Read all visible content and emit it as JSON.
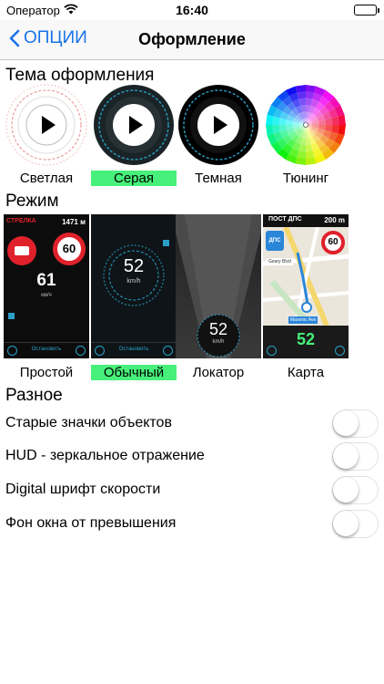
{
  "status_bar": {
    "carrier": "Оператор",
    "time": "16:40"
  },
  "nav": {
    "back_label": "ОПЦИИ",
    "title": "Оформление"
  },
  "theme_section": {
    "title": "Тема оформления",
    "items": [
      {
        "label": "Светлая",
        "selected": false
      },
      {
        "label": "Серая",
        "selected": true
      },
      {
        "label": "Темная",
        "selected": false
      },
      {
        "label": "Тюнинг",
        "selected": false
      }
    ]
  },
  "mode_section": {
    "title": "Режим",
    "items": [
      {
        "label": "Простой",
        "selected": false
      },
      {
        "label": "Обычный",
        "selected": true
      },
      {
        "label": "Локатор",
        "selected": false
      },
      {
        "label": "Карта",
        "selected": false
      }
    ],
    "previews": {
      "simple": {
        "header": "СТРЕЛКА",
        "distance": "1471 м",
        "limit": "60",
        "speed": "61",
        "unit": "км/ч",
        "stop": "Остановить"
      },
      "normal": {
        "speed": "52",
        "unit": "km/h",
        "stop": "Остановить"
      },
      "locator": {
        "speed": "52",
        "unit": "km/h"
      },
      "map": {
        "header": "ПОСТ ДПС",
        "distance": "200 m",
        "badge": "ДПС",
        "limit": "60",
        "street1": "Geary Blvd",
        "street2": "Masonic Ave",
        "speed": "52"
      }
    }
  },
  "misc_section": {
    "title": "Разное",
    "items": [
      {
        "label": "Старые значки объектов",
        "on": false
      },
      {
        "label": "HUD - зеркальное отражение",
        "on": false
      },
      {
        "label": "Digital шрифт скорости",
        "on": false
      },
      {
        "label": "Фон окна от превышения",
        "on": false
      }
    ]
  },
  "colors": {
    "accent": "#1a73e8",
    "selected": "#47f07a",
    "speed_limit": "#e0212b"
  }
}
